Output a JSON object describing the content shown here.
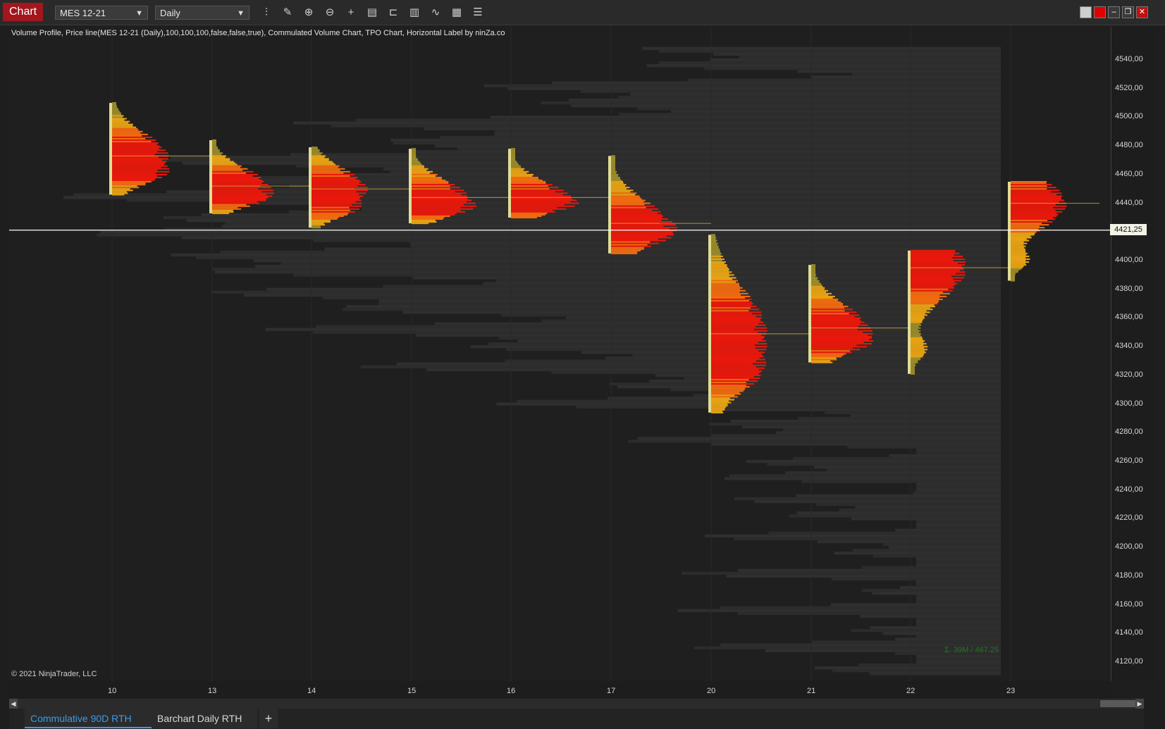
{
  "titlebar": {
    "chart_tab": "Chart",
    "instrument": "MES 12-21",
    "period": "Daily",
    "tools": [
      "bar-type-icon",
      "draw-icon",
      "zoom-in-icon",
      "zoom-out-icon",
      "crosshair-icon",
      "data-box-icon",
      "properties-icon",
      "indicators-icon",
      "strategies-icon",
      "templates-icon",
      "list-icon"
    ]
  },
  "chart": {
    "indicator_label": "Volume Profile, Price line(MES 12-21 (Daily),100,100,100,false,false,true), Commulated Volume Chart, TPO Chart, Horizontal Label by ninZa.co",
    "copyright": "© 2021 NinjaTrader, LLC",
    "sigma_label": "Σ. 39M / 467.25",
    "current_price": "4421,25",
    "price_ticks": [
      "4540,00",
      "4520,00",
      "4500,00",
      "4480,00",
      "4460,00",
      "4440,00",
      "4400,00",
      "4380,00",
      "4360,00",
      "4340,00",
      "4320,00",
      "4300,00",
      "4280,00",
      "4260,00",
      "4240,00",
      "4220,00",
      "4200,00",
      "4180,00",
      "4160,00",
      "4140,00",
      "4120,00"
    ],
    "date_ticks": [
      "10",
      "13",
      "14",
      "15",
      "16",
      "17",
      "20",
      "21",
      "22",
      "23"
    ],
    "colors": {
      "hvn": "#e8180c",
      "mid": "#f06a10",
      "high": "#e6a214",
      "low": "#9a8a2a",
      "tpo": "#f5f0a0",
      "priceline": "#ffffff",
      "poc": "#e6c24a"
    }
  },
  "chart_data": {
    "type": "volume-profile",
    "instrument": "MES 12-21",
    "period": "Daily",
    "current_price": 4421.25,
    "ylim": [
      4110,
      4550
    ],
    "x": [
      "10",
      "13",
      "14",
      "15",
      "16",
      "17",
      "20",
      "21",
      "22",
      "23"
    ],
    "sessions": [
      {
        "date": "10",
        "high": 4510,
        "low": 4446,
        "poc": 4473
      },
      {
        "date": "13",
        "high": 4484,
        "low": 4433,
        "poc": 4452
      },
      {
        "date": "14",
        "high": 4479,
        "low": 4423,
        "poc": 4450
      },
      {
        "date": "15",
        "high": 4478,
        "low": 4426,
        "poc": 4444
      },
      {
        "date": "16",
        "high": 4478,
        "low": 4430,
        "poc": 4444
      },
      {
        "date": "17",
        "high": 4473,
        "low": 4405,
        "poc": 4426
      },
      {
        "date": "20",
        "high": 4418,
        "low": 4294,
        "poc": 4349
      },
      {
        "date": "21",
        "high": 4397,
        "low": 4329,
        "poc": 4353
      },
      {
        "date": "22",
        "high": 4407,
        "low": 4321,
        "poc": 4395
      },
      {
        "date": "23",
        "high": 4455,
        "low": 4386,
        "poc": 4440
      }
    ]
  },
  "tabs": {
    "items": [
      "Commulative 90D RTH",
      "Barchart Daily RTH"
    ],
    "add_label": "+"
  }
}
